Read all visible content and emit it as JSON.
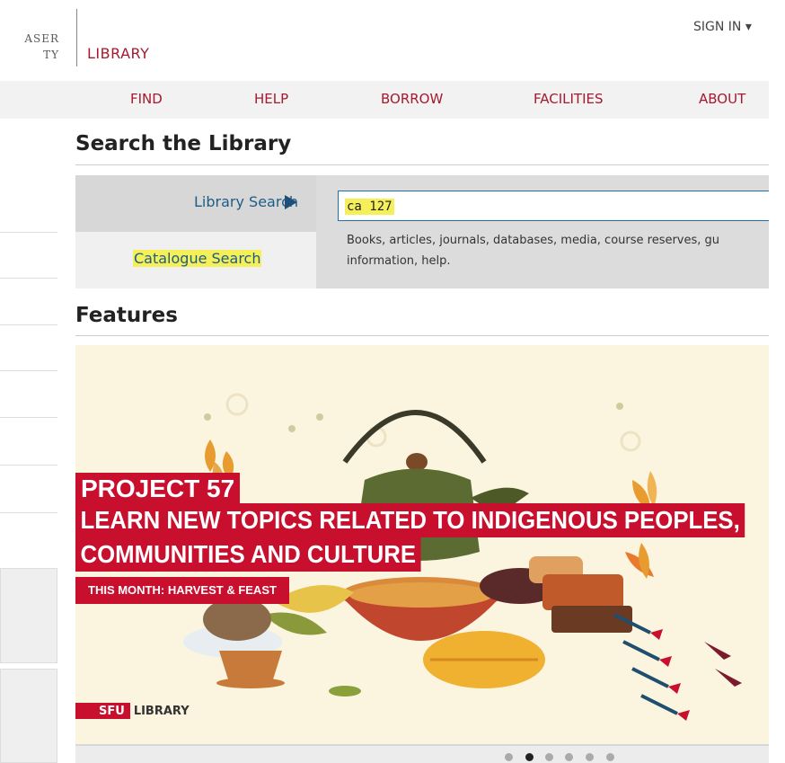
{
  "header": {
    "university_fragment": [
      "ASER",
      "TY"
    ],
    "library_title": "LIBRARY",
    "sign_in": "SIGN IN ▾"
  },
  "nav": {
    "items": [
      {
        "label": "FIND"
      },
      {
        "label": "HELP"
      },
      {
        "label": "BORROW"
      },
      {
        "label": "FACILITIES"
      },
      {
        "label": "ABOUT"
      }
    ]
  },
  "search": {
    "heading": "Search the Library",
    "tabs": [
      {
        "label": "Library Search"
      },
      {
        "label": "Catalogue Search"
      }
    ],
    "input_value": "ca 127",
    "description_lines": [
      "Books, articles, journals, databases, media, course reserves, gu",
      "information, help."
    ]
  },
  "features": {
    "heading": "Features",
    "banner": {
      "line1": "PROJECT 57",
      "line2": "LEARN NEW TOPICS RELATED TO INDIGENOUS PEOPLES,",
      "line3": "COMMUNITIES AND CULTURE",
      "subline": "THIS MONTH: HARVEST & FEAST",
      "logo_box": "SFU",
      "logo_text": "LIBRARY"
    },
    "carousel": {
      "slide_count": 6,
      "active_index": 1
    }
  },
  "colors": {
    "brand_red": "#a6192e",
    "banner_red": "#c8102e",
    "link_blue": "#1f5c85",
    "highlight": "#f5f05a"
  }
}
